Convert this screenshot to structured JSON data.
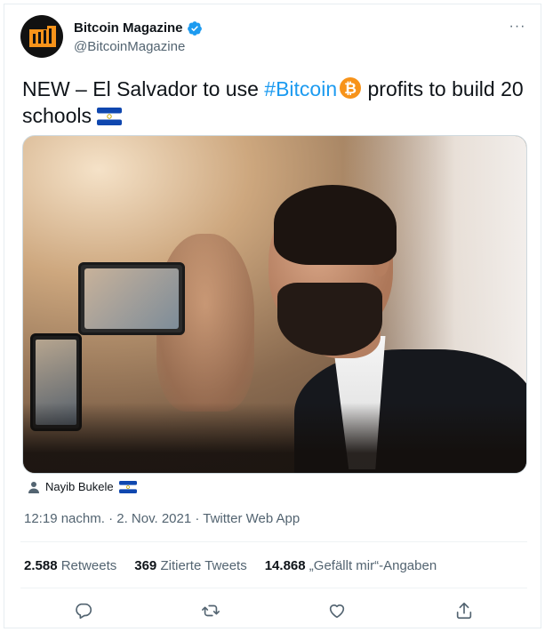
{
  "author": {
    "name": "Bitcoin Magazine",
    "handle": "@BitcoinMagazine",
    "verified_icon": "verified-badge-icon",
    "avatar_icon": "bitcoin-magazine-logo"
  },
  "menu": {
    "more_label": "···"
  },
  "tweet": {
    "text_part1": "NEW  – El Salvador to use ",
    "hashtag": "#Bitcoin",
    "text_part2": "profits to build 20  schools",
    "emoji_icons": [
      "bitcoin-icon",
      "el-salvador-flag-icon"
    ]
  },
  "media": {
    "tagged_person": "Nayib Bukele",
    "person_icon": "person-icon",
    "flag_icon": "el-salvador-flag-icon"
  },
  "meta": {
    "time": "12:19 nachm.",
    "separator": " · ",
    "date": "2. Nov. 2021",
    "source": "Twitter Web App"
  },
  "stats": {
    "retweets_count": "2.588",
    "retweets_label": "Retweets",
    "quotes_count": "369",
    "quotes_label": "Zitierte Tweets",
    "likes_count": "14.868",
    "likes_label": "„Gefällt mir“-Angaben"
  },
  "actions": [
    "reply-icon",
    "retweet-icon",
    "like-icon",
    "share-icon"
  ],
  "colors": {
    "accent": "#1d9bf0",
    "text": "#0f1419",
    "secondary": "#536471",
    "bitcoin": "#f7931a"
  }
}
